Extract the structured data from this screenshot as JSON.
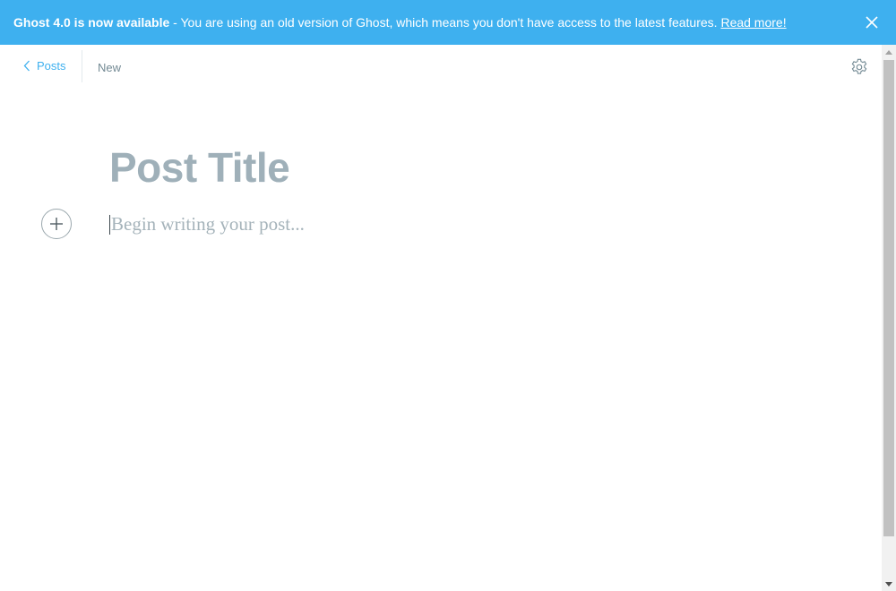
{
  "banner": {
    "strong_text": "Ghost 4.0 is now available",
    "message": " - You are using an old version of Ghost, which means you don't have access to the latest features. ",
    "link_text": "Read more!",
    "bg_color": "#3eb0ef",
    "close_icon": "close-icon"
  },
  "topbar": {
    "back_label": "Posts",
    "status_label": "New",
    "settings_icon": "gear-icon"
  },
  "editor": {
    "title_placeholder": "Post Title",
    "body_placeholder": "Begin writing your post...",
    "add_card_icon": "plus-icon"
  },
  "colors": {
    "accent": "#3eb0ef",
    "placeholder": "#9fb0b9"
  }
}
